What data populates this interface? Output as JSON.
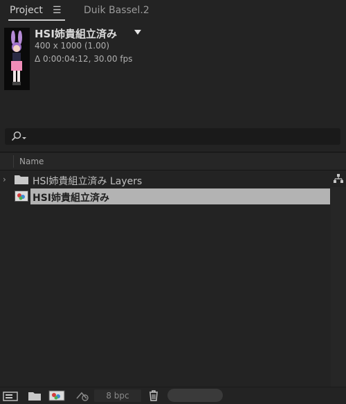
{
  "tabs": {
    "project_label": "Project",
    "menu_glyph": "☰",
    "duik_label": "Duik Bassel.2"
  },
  "composition": {
    "title": "HSI姉貴組立済み",
    "dimensions": "400 x 1000 (1.00)",
    "duration": "Δ 0:00:04:12, 30.00 fps"
  },
  "table": {
    "column_name": "Name",
    "rows": [
      {
        "type": "folder",
        "label": "HSI姉貴組立済み Layers",
        "selected": false
      },
      {
        "type": "composition",
        "label": "HSI姉貴組立済み",
        "selected": true
      }
    ]
  },
  "bottom_bar": {
    "bpc_label": "8 bpc"
  },
  "colors": {
    "panel_bg": "#232323",
    "selection": "#b3b3b3"
  }
}
